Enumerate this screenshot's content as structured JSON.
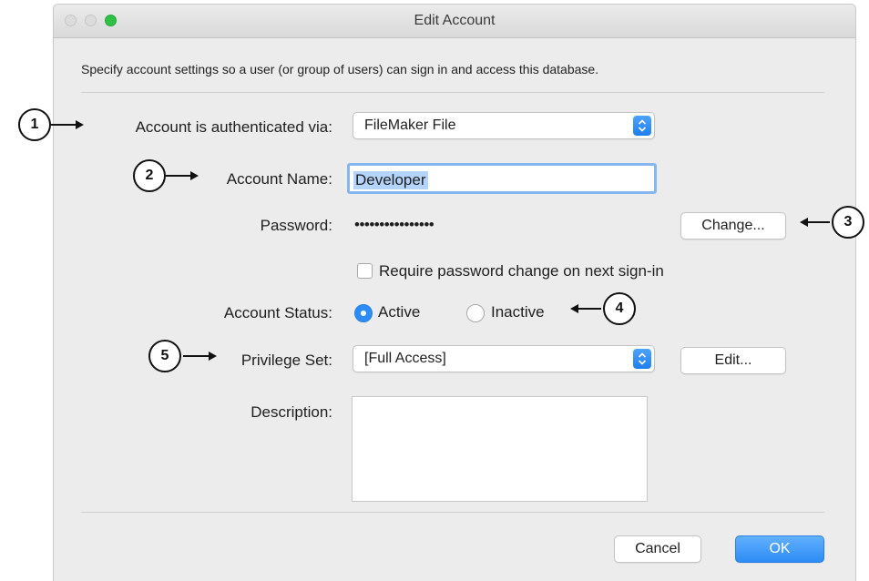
{
  "window": {
    "title": "Edit Account"
  },
  "intro": "Specify account settings so a user (or group of users) can sign in and access this database.",
  "auth": {
    "label": "Account is authenticated via:",
    "value": "FileMaker File"
  },
  "account_name": {
    "label": "Account Name:",
    "value": "Developer"
  },
  "password": {
    "label": "Password:",
    "value": "••••••••••••••••",
    "change_button": "Change..."
  },
  "require_change": {
    "label": "Require password change on next sign-in",
    "checked": false
  },
  "status": {
    "label": "Account Status:",
    "options": [
      "Active",
      "Inactive"
    ],
    "selected": "Active"
  },
  "privilege": {
    "label": "Privilege Set:",
    "value": "[Full Access]",
    "edit_button": "Edit..."
  },
  "description": {
    "label": "Description:",
    "value": ""
  },
  "buttons": {
    "cancel": "Cancel",
    "ok": "OK"
  },
  "callouts": [
    "1",
    "2",
    "3",
    "4",
    "5"
  ],
  "colors": {
    "accent": "#2d8cf5",
    "selection": "#b4d4fb",
    "zoom_button": "#2fc146"
  }
}
